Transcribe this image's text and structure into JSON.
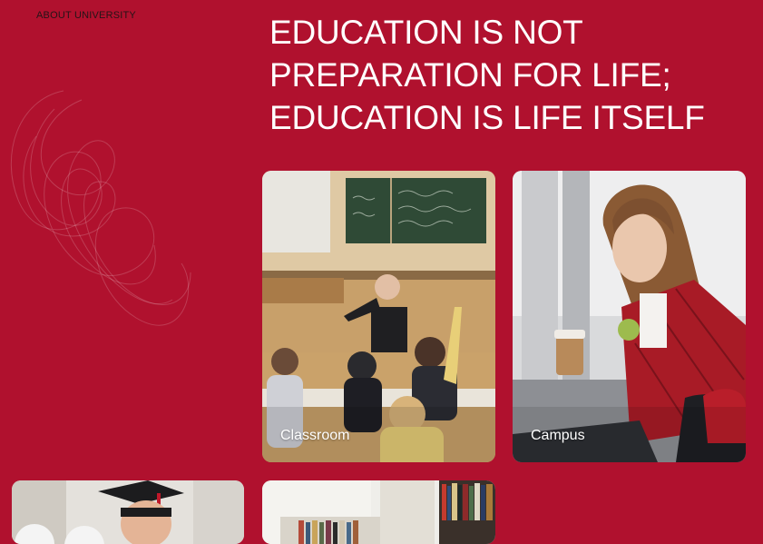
{
  "section_label": "ABOUT UNIVERSITY",
  "headline": {
    "lines": [
      "EDUCATION IS NOT",
      "PREPARATION FOR LIFE;",
      "EDUCATION IS LIFE ITSELF"
    ]
  },
  "cards": {
    "classroom": {
      "caption": "Classroom"
    },
    "campus": {
      "caption": "Campus"
    }
  },
  "colors": {
    "background": "#b0112e",
    "headline_text": "#ffffff",
    "label_text": "#231417"
  }
}
